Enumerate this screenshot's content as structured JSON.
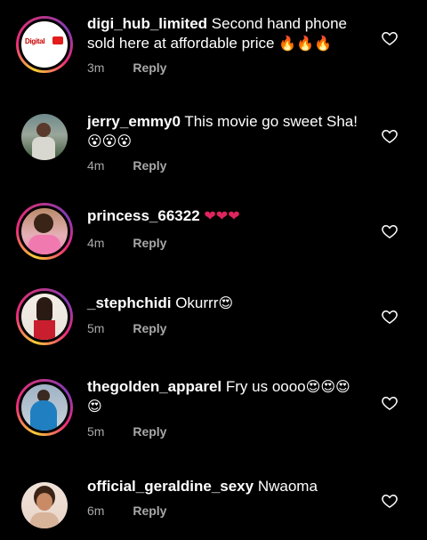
{
  "comments": [
    {
      "username": "digi_hub_limited",
      "text": "Second hand phone sold here at affordable price",
      "emoji": "🔥🔥🔥",
      "time": "3m",
      "reply": "Reply",
      "avatar_logo": "Digital",
      "ring": true
    },
    {
      "username": "jerry_emmy0",
      "text": "This movie go sweet Sha!",
      "emoji": "😮😮😮",
      "time": "4m",
      "reply": "Reply",
      "ring": false
    },
    {
      "username": "princess_66322",
      "text": "",
      "emoji": "❤❤❤",
      "time": "4m",
      "reply": "Reply",
      "ring": true
    },
    {
      "username": "_stephchidi",
      "text": "Okurrr",
      "emoji": "😍",
      "time": "5m",
      "reply": "Reply",
      "ring": true
    },
    {
      "username": "thegolden_apparel",
      "text": "Fry us oooo",
      "emoji": "😍😍😍😍",
      "time": "5m",
      "reply": "Reply",
      "ring": true
    },
    {
      "username": "official_geraldine_sexy",
      "text": "Nwaoma",
      "emoji": "",
      "time": "6m",
      "reply": "Reply",
      "ring": false
    }
  ],
  "icons": {
    "like": "heart-outline-icon"
  },
  "colors": {
    "background": "#000000",
    "meta": "#a8a8a8",
    "heart_emoji": "#e0245e"
  }
}
